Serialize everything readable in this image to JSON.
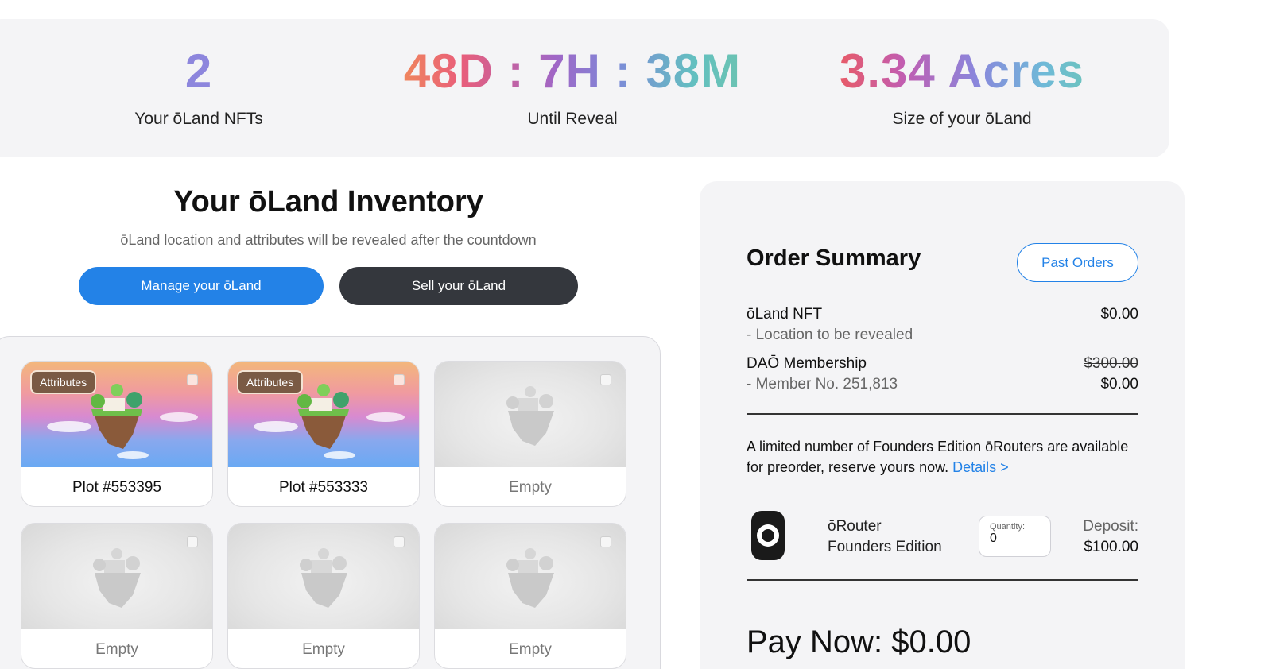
{
  "stats": {
    "nfts": {
      "value": "2",
      "label": "Your ōLand NFTs"
    },
    "countdown": {
      "value": "48D : 7H : 38M",
      "label": "Until Reveal"
    },
    "size": {
      "value": "3.34 Acres",
      "label": "Size of your ōLand"
    }
  },
  "inventory": {
    "title": "Your ōLand Inventory",
    "subtitle": "ōLand location and attributes will be revealed after the countdown",
    "manage_label": "Manage your ōLand",
    "sell_label": "Sell your ōLand",
    "cards": [
      {
        "caption": "Plot #553395",
        "badge": "Attributes",
        "state": "owned"
      },
      {
        "caption": "Plot #553333",
        "badge": "Attributes",
        "state": "owned"
      },
      {
        "caption": "Empty",
        "state": "empty"
      },
      {
        "caption": "Empty",
        "state": "empty"
      },
      {
        "caption": "Empty",
        "state": "empty"
      },
      {
        "caption": "Empty",
        "state": "empty"
      }
    ]
  },
  "order": {
    "title": "Order Summary",
    "past_orders_label": "Past Orders",
    "items": [
      {
        "name": "ōLand NFT",
        "detail": "- Location to be revealed",
        "price": "$0.00"
      },
      {
        "name": "DAŌ Membership",
        "detail": "- Member No. 251,813",
        "original_price": "$300.00",
        "price": "$0.00"
      }
    ],
    "promo_text": "A limited number of Founders Edition ōRouters are available for preorder, reserve yours now.",
    "promo_link": "Details >",
    "router": {
      "name_line1": "ōRouter",
      "name_line2": "Founders Edition",
      "quantity_label": "Quantity:",
      "quantity_value": "0",
      "deposit_label": "Deposit:",
      "deposit_value": "$100.00"
    },
    "pay_now": "Pay Now: $0.00"
  }
}
